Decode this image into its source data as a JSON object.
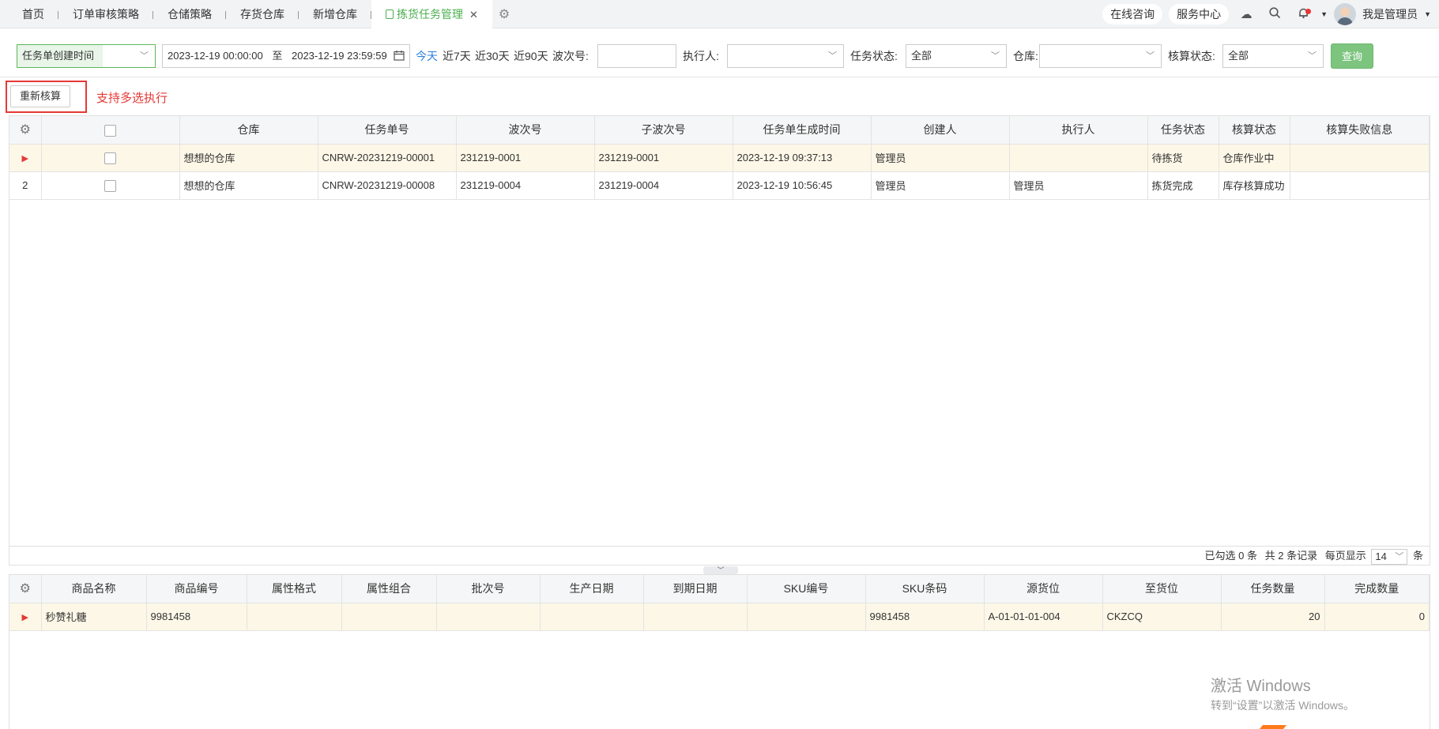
{
  "tabs": [
    {
      "label": "首页",
      "active": false
    },
    {
      "label": "订单审核策略",
      "active": false
    },
    {
      "label": "仓储策略",
      "active": false
    },
    {
      "label": "存货仓库",
      "active": false
    },
    {
      "label": "新增仓库",
      "active": false
    },
    {
      "label": "拣货任务管理",
      "active": true
    }
  ],
  "topright": {
    "consult": "在线咨询",
    "service": "服务中心",
    "user": "我是管理员"
  },
  "filter": {
    "date_type": "任务单创建时间",
    "date_start": "2023-12-19 00:00:00",
    "date_to": "至",
    "date_end": "2023-12-19 23:59:59",
    "quick_today": "今天",
    "quick_7": "近7天",
    "quick_30": "近30天",
    "quick_90": "近90天",
    "wave_label": "波次号:",
    "wave_value": "",
    "executor_label": "执行人:",
    "executor_value": "",
    "task_status_label": "任务状态:",
    "task_status_value": "全部",
    "warehouse_label": "仓库:",
    "warehouse_value": "",
    "account_status_label": "核算状态:",
    "account_status_value": "全部",
    "query": "查询"
  },
  "actions": {
    "recalc": "重新核算",
    "note": "支持多选执行"
  },
  "task_table": {
    "columns": [
      "仓库",
      "任务单号",
      "波次号",
      "子波次号",
      "任务单生成时间",
      "创建人",
      "执行人",
      "任务状态",
      "核算状态",
      "核算失败信息"
    ],
    "rows": [
      {
        "idx": "",
        "cells": [
          "想想的仓库",
          "CNRW-20231219-00001",
          "231219-0001",
          "231219-0001",
          "2023-12-19 09:37:13",
          "管理员",
          "",
          "待拣货",
          "仓库作业中",
          ""
        ]
      },
      {
        "idx": "2",
        "cells": [
          "想想的仓库",
          "CNRW-20231219-00008",
          "231219-0004",
          "231219-0004",
          "2023-12-19 10:56:45",
          "管理员",
          "管理员",
          "拣货完成",
          "库存核算成功",
          ""
        ]
      }
    ]
  },
  "footer": {
    "selected": "已勾选 0 条",
    "total": "共 2 条记录",
    "per_page_label": "每页显示",
    "per_page": "14",
    "unit": "条"
  },
  "detail_table": {
    "columns": [
      "商品名称",
      "商品编号",
      "属性格式",
      "属性组合",
      "批次号",
      "生产日期",
      "到期日期",
      "SKU编号",
      "SKU条码",
      "源货位",
      "至货位",
      "任务数量",
      "完成数量"
    ],
    "rows": [
      {
        "cells": [
          "秒赞礼糖",
          "9981458",
          "",
          "",
          "",
          "",
          "",
          "",
          "9981458",
          "A-01-01-01-004",
          "CKZCQ",
          "20",
          "0"
        ]
      }
    ]
  },
  "watermark": {
    "line1": "激活 Windows",
    "line2": "转到“设置”以激活 Windows。"
  },
  "colors": {
    "accent": "#4caf50",
    "highlight_row": "#fdf7e7",
    "annotation": "#e53935"
  }
}
